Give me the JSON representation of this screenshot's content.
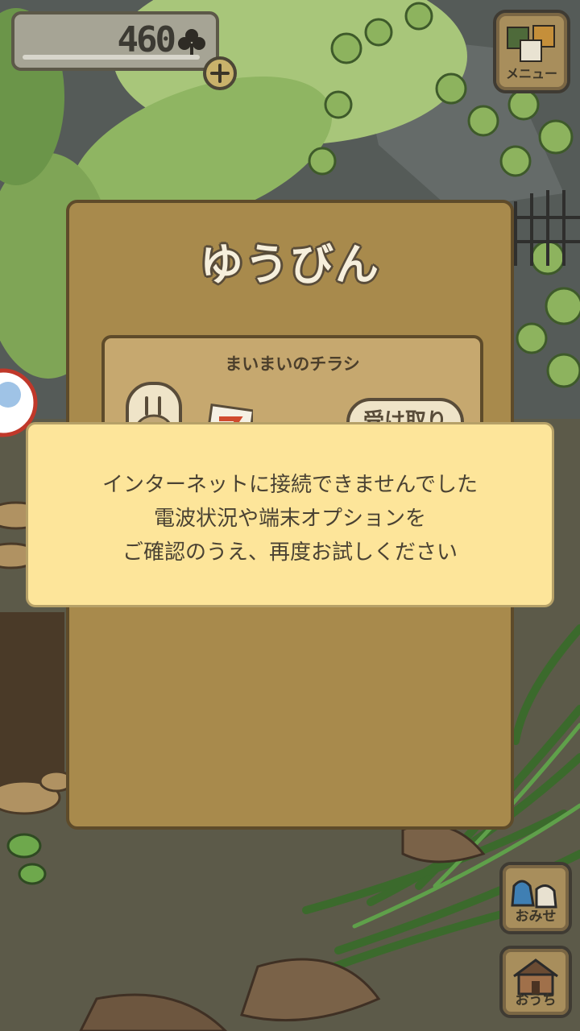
{
  "hud": {
    "clover_count": "460",
    "clover_icon": "clover-icon",
    "add_icon": "plus-icon",
    "menu_label": "メニュー",
    "menu_icon": "menu-tiles-icon"
  },
  "side_buttons": {
    "shop_label": "おみせ",
    "shop_icon": "shop-bags-icon",
    "home_label": "おうち",
    "home_icon": "house-icon"
  },
  "mail_panel": {
    "title": "ゆうびん",
    "items": [
      {
        "title": "まいまいのチラシ",
        "sender_icon": "snail-avatar",
        "attachment_icon": "flyer-icon",
        "receive_label": "受け取り"
      }
    ]
  },
  "error_dialog": {
    "lines": [
      "インターネットに接続できませんでした",
      "電波状況や端末オプションを",
      "ご確認のうえ、再度お試しください"
    ]
  },
  "colors": {
    "panel_bg": "#a88a4c",
    "panel_border": "#5e4b2a",
    "dialog_bg": "#fde59a",
    "dialog_text": "#4a4233"
  }
}
